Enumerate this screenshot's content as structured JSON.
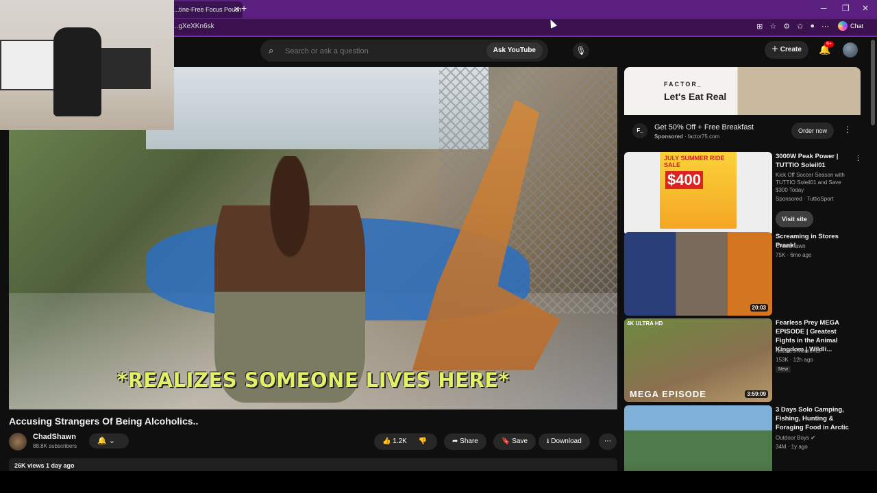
{
  "browser": {
    "tab_title": "...tine-Free Focus Pouch",
    "tab_close": "✕",
    "new_tab": "+",
    "url": "...gXeXKn6sk",
    "chat_label": "Chat"
  },
  "youtube": {
    "search_placeholder": "Search or ask a question",
    "ask_youtube": "Ask YouTube",
    "create": "Create",
    "notif_badge": "9+"
  },
  "video": {
    "caption": "*REALIZES SOMEONE LIVES HERE*",
    "title": "Accusing Strangers Of Being Alcoholics..",
    "channel": "ChadShawn",
    "subscribers": "88.8K subscribers",
    "likes": "1.2K",
    "share": "Share",
    "save": "Save",
    "download": "Download",
    "views_date": "26K views  1 day ago"
  },
  "ad": {
    "brand": "FACTOR_",
    "slogan": "Let's Eat Real",
    "headline": "Get 50% Off + Free Breakfast",
    "sponsored": "Sponsored",
    "domain": "factor75.com",
    "cta": "Order now",
    "logo_text": "F_"
  },
  "recommendations": [
    {
      "title": "3000W Peak Power | TUTTIO Soleil01",
      "meta1": "Kick Off Soccer Season with TUTTIO Soleil01 and Save $300 Today",
      "meta2": "Sponsored · TuttioSport",
      "cta": "Visit site",
      "thumb_text": "JULY SUMMER RIDE SALE",
      "thumb_price": "$400"
    },
    {
      "title": "Screaming in Stores Prank!",
      "meta1": "ChadShawn",
      "meta2": "75K · 6mo ago",
      "duration": "20:03"
    },
    {
      "title": "Fearless Prey MEGA EPISODE | Greatest Fights in the Animal Kingdom | Wildli...",
      "meta1": "Nature's Moments",
      "meta2": "153K · 12h ago",
      "badge": "New",
      "duration": "3:59:09",
      "thumb_text": "MEGA EPISODE",
      "thumb_corner": "4K ULTRA HD"
    },
    {
      "title": "3 Days Solo Camping, Fishing, Hunting & Foraging Food in Arctic",
      "meta1": "Outdoor Boys ✔",
      "meta2": "34M · 1y ago"
    }
  ]
}
